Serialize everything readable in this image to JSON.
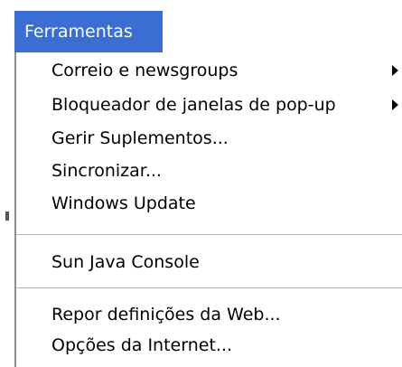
{
  "menu": {
    "title": "Ferramentas",
    "items": [
      {
        "label": "Correio e newsgroups",
        "has_submenu": true
      },
      {
        "label": "Bloqueador de janelas de pop-up",
        "has_submenu": true
      },
      {
        "label": "Gerir Suplementos...",
        "has_submenu": false
      },
      {
        "label": "Sincronizar...",
        "has_submenu": false
      },
      {
        "label": "Windows Update",
        "has_submenu": false
      },
      {
        "label": "Sun Java Console",
        "has_submenu": false
      },
      {
        "label": "Repor definições da Web...",
        "has_submenu": false
      },
      {
        "label": "Opções da Internet...",
        "has_submenu": false
      }
    ]
  }
}
